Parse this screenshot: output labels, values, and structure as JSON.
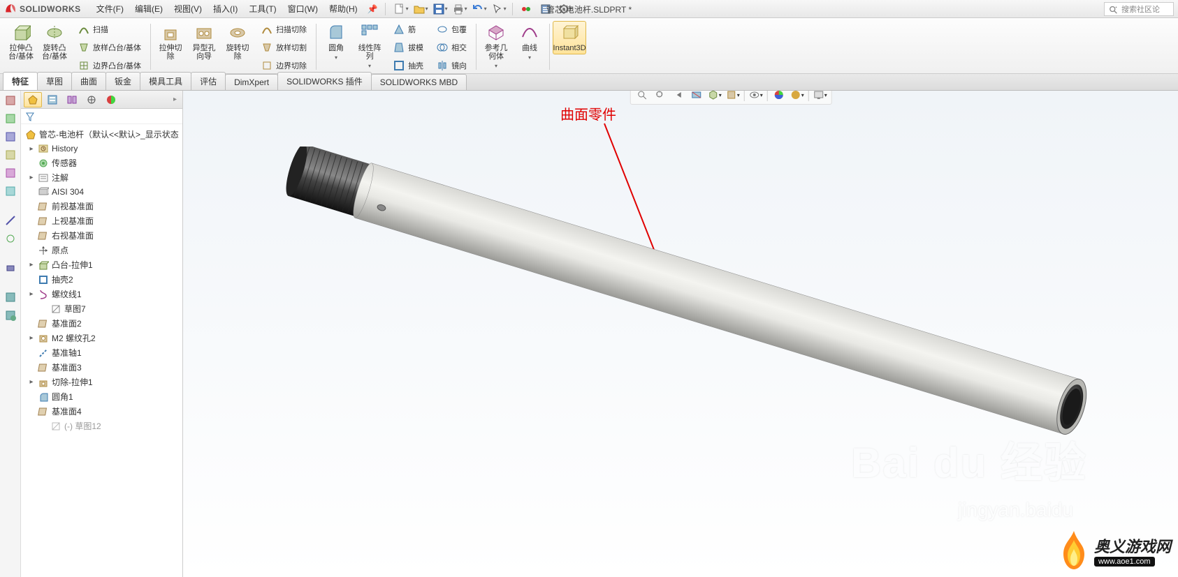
{
  "app": {
    "name": "SOLIDWORKS",
    "doc_title": "管芯-电池杆.SLDPRT *"
  },
  "search": {
    "placeholder": "搜索社区论"
  },
  "menu": [
    {
      "label": "文件(F)"
    },
    {
      "label": "编辑(E)"
    },
    {
      "label": "视图(V)"
    },
    {
      "label": "插入(I)"
    },
    {
      "label": "工具(T)"
    },
    {
      "label": "窗口(W)"
    },
    {
      "label": "帮助(H)"
    }
  ],
  "ribbon": {
    "g1_big1": "拉伸凸\n台/基体",
    "g1_big2": "旋转凸\n台/基体",
    "g1_s1": "扫描",
    "g1_s2": "放样凸台/基体",
    "g1_s3": "边界凸台/基体",
    "g2_big1": "拉伸切\n除",
    "g2_big2": "异型孔\n向导",
    "g2_big3": "旋转切\n除",
    "g2_s1": "扫描切除",
    "g2_s2": "放样切割",
    "g2_s3": "边界切除",
    "g3_big1": "圆角",
    "g3_big2": "线性阵\n列",
    "g3_s1": "筋",
    "g3_s2": "拔模",
    "g3_s3": "抽壳",
    "g3_s4": "包覆",
    "g3_s5": "相交",
    "g3_s6": "镜向",
    "g4_big1": "参考几\n何体",
    "g4_big2": "曲线",
    "g4_big3": "Instant3D"
  },
  "tabs": [
    "特征",
    "草图",
    "曲面",
    "钣金",
    "模具工具",
    "评估",
    "DimXpert",
    "SOLIDWORKS 插件",
    "SOLIDWORKS MBD"
  ],
  "tree": {
    "root": "管芯-电池杆（默认<<默认>_显示状态",
    "items": [
      {
        "label": "History",
        "expand": "▸"
      },
      {
        "label": "传感器"
      },
      {
        "label": "注解",
        "expand": "▸"
      },
      {
        "label": "AISI 304"
      },
      {
        "label": "前视基准面"
      },
      {
        "label": "上视基准面"
      },
      {
        "label": "右视基准面"
      },
      {
        "label": "原点"
      },
      {
        "label": "凸台-拉伸1",
        "expand": "▸"
      },
      {
        "label": "抽壳2"
      },
      {
        "label": "螺纹线1",
        "expand": "▸"
      },
      {
        "label": "草图7",
        "child": true
      },
      {
        "label": "基准面2"
      },
      {
        "label": "M2 螺纹孔2",
        "expand": "▸"
      },
      {
        "label": "基准轴1"
      },
      {
        "label": "基准面3"
      },
      {
        "label": "切除-拉伸1",
        "expand": "▸"
      },
      {
        "label": "圆角1"
      },
      {
        "label": "基准面4"
      },
      {
        "label": "(-) 草图12",
        "child": true,
        "dim": true
      }
    ]
  },
  "annotation": "曲面零件",
  "watermark": {
    "line1": "Bai du 经验",
    "line2": "jingyan.baidu"
  },
  "site": {
    "name": "奥义游戏网",
    "url": "www.aoe1.com"
  }
}
